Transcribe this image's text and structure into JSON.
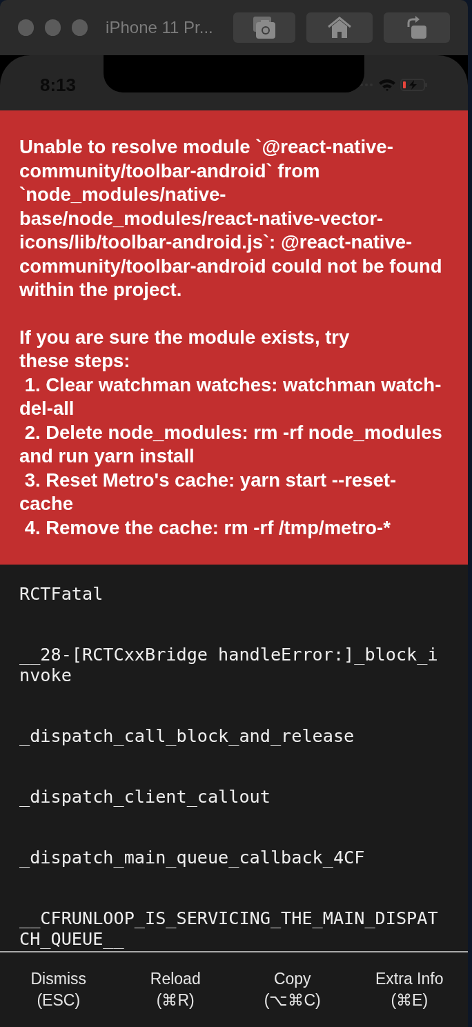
{
  "window": {
    "title": "iPhone 11 Pr..."
  },
  "status_bar": {
    "time": "8:13"
  },
  "error": {
    "message": "Unable to resolve module `@react-native-community/toolbar-android` from `node_modules/native-base/node_modules/react-native-vector-icons/lib/toolbar-android.js`: @react-native-community/toolbar-android could not be found within the project.",
    "hint": "If you are sure the module exists, try these steps:",
    "steps": [
      " 1. Clear watchman watches: watchman watch-del-all",
      " 2. Delete node_modules: rm -rf node_modules and run yarn install",
      " 3. Reset Metro's cache: yarn start --reset-cache",
      " 4. Remove the cache: rm -rf /tmp/metro-*"
    ]
  },
  "stack": [
    "RCTFatal",
    "__28-[RCTCxxBridge handleError:]_block_invoke",
    "_dispatch_call_block_and_release",
    "_dispatch_client_callout",
    "_dispatch_main_queue_callback_4CF",
    "__CFRUNLOOP_IS_SERVICING_THE_MAIN_DISPATCH_QUEUE__"
  ],
  "actions": [
    {
      "label": "Dismiss",
      "shortcut": "(ESC)"
    },
    {
      "label": "Reload",
      "shortcut": "(⌘R)"
    },
    {
      "label": "Copy",
      "shortcut": "(⌥⌘C)"
    },
    {
      "label": "Extra Info",
      "shortcut": "(⌘E)"
    }
  ]
}
